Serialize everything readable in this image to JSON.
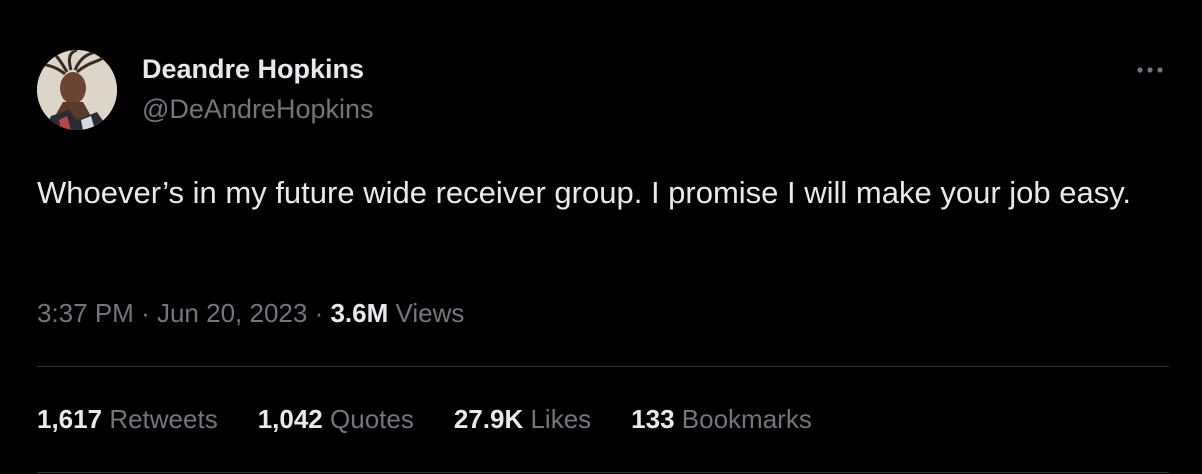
{
  "author": {
    "display_name": "Deandre Hopkins",
    "handle": "@DeAndreHopkins"
  },
  "tweet": {
    "text": "Whoever’s in my future wide receiver group. I promise I will make your job easy."
  },
  "meta": {
    "time": "3:37 PM",
    "separator": "·",
    "date": "Jun 20, 2023",
    "views_count": "3.6M",
    "views_label": "Views"
  },
  "stats": {
    "retweets": {
      "count": "1,617",
      "label": "Retweets"
    },
    "quotes": {
      "count": "1,042",
      "label": "Quotes"
    },
    "likes": {
      "count": "27.9K",
      "label": "Likes"
    },
    "bookmarks": {
      "count": "133",
      "label": "Bookmarks"
    }
  },
  "icons": {
    "more": "more-horizontal-icon"
  },
  "colors": {
    "background": "#000000",
    "primary_text": "#e7e9ea",
    "secondary_text": "#71767b",
    "divider": "#2f3336"
  }
}
